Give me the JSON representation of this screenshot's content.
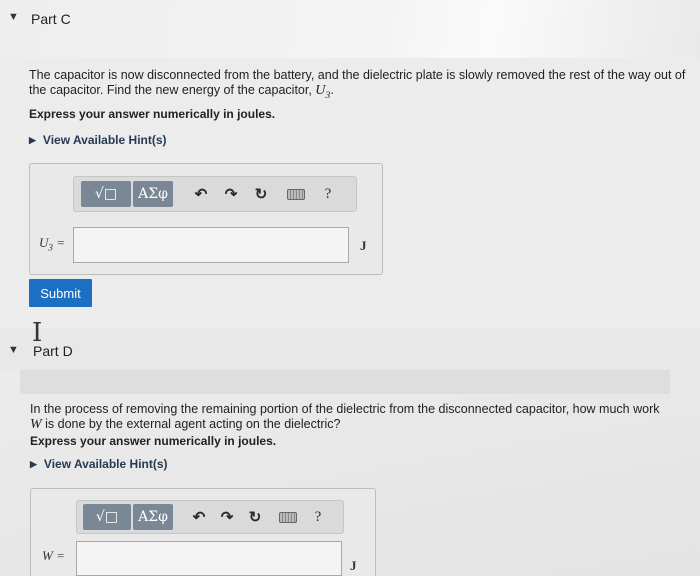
{
  "part_c": {
    "title": "Part C",
    "question_pre": "The capacitor is now disconnected from the battery, and the dielectric plate is slowly removed the rest of the way out of the capacitor. Find the new energy of the capacitor, ",
    "question_var": "U3",
    "question_post": ".",
    "instruction": "Express your answer numerically in joules.",
    "hint_label": "View Available Hint(s)",
    "toolbar": {
      "templates_label": "√□",
      "symbols_label": "ΑΣφ",
      "undo": "↶",
      "redo": "↷",
      "reset": "↻",
      "help": "?"
    },
    "input_label": "U3 =",
    "input_value": "",
    "unit": "J",
    "submit_label": "Submit"
  },
  "part_d": {
    "title": "Part D",
    "question_pre": "In the process of removing the remaining portion of the dielectric from the disconnected capacitor, how much work ",
    "question_var": "W",
    "question_post": " is done by the external agent acting on the dielectric?",
    "instruction": "Express your answer numerically in joules.",
    "hint_label": "View Available Hint(s)",
    "toolbar": {
      "templates_label": "√□",
      "symbols_label": "ΑΣφ",
      "undo": "↶",
      "redo": "↷",
      "reset": "↻",
      "help": "?"
    },
    "input_label": "W =",
    "input_value": "",
    "unit": "J"
  }
}
